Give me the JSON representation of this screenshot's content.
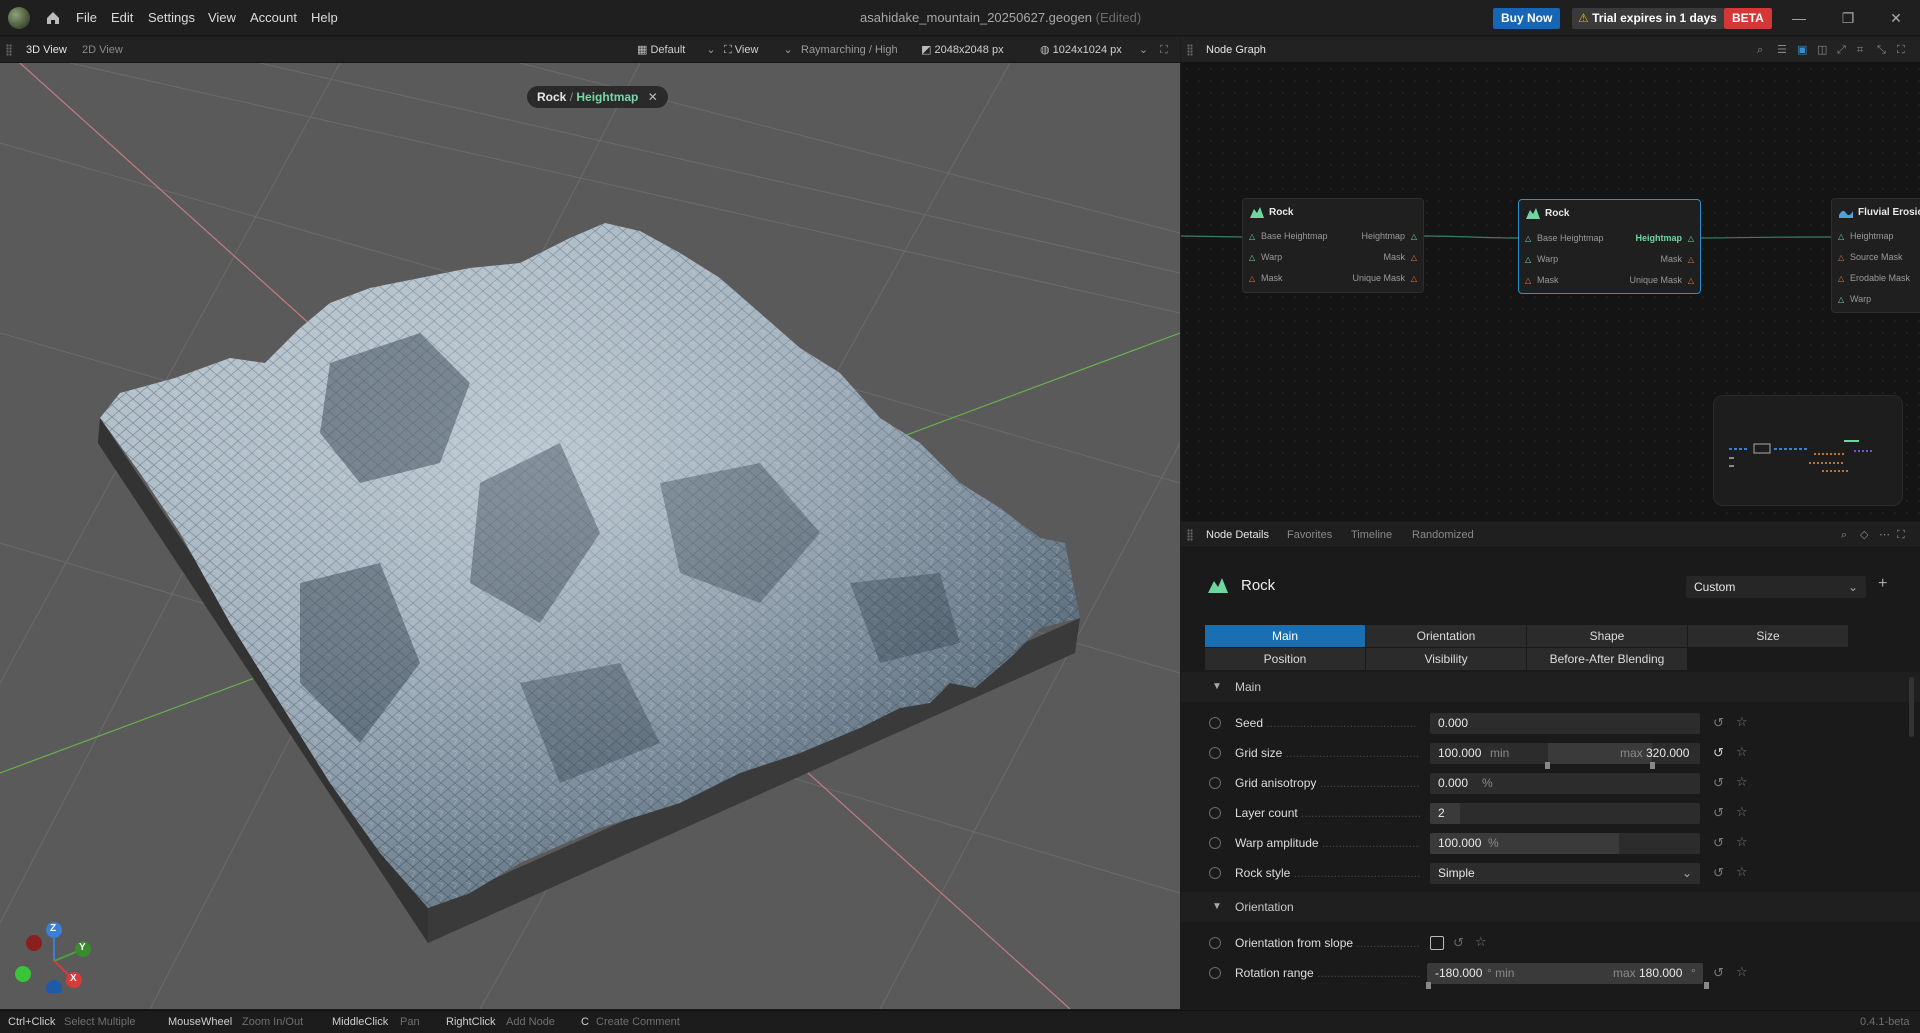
{
  "titlebar": {
    "menu": [
      "File",
      "Edit",
      "Settings",
      "View",
      "Account",
      "Help"
    ],
    "document_title": "asahidake_mountain_20250627.geogen",
    "edited_flag": "(Edited)",
    "buy_now": "Buy Now",
    "trial_text": "Trial expires in 1 days",
    "beta": "BETA"
  },
  "viewport_tabs": {
    "tabs": [
      "3D View",
      "2D View"
    ],
    "preset": "Default",
    "view": "View",
    "render_mode": "Raymarching / High",
    "resolution": "2048x2048 px",
    "preview_res": "1024x1024 px"
  },
  "viewport": {
    "breadcrumb_node": "Rock",
    "breadcrumb_sep": "/",
    "breadcrumb_output": "Heightmap",
    "axis_z": "Z",
    "axis_y": "Y",
    "axis_x": "X"
  },
  "graph": {
    "tab": "Node Graph",
    "nodes": [
      {
        "title": "Rock",
        "inputs": [
          "Base Heightmap",
          "Warp",
          "Mask"
        ],
        "outputs": [
          "Heightmap",
          "Mask",
          "Unique Mask"
        ]
      },
      {
        "title": "Rock",
        "inputs": [
          "Base Heightmap",
          "Warp",
          "Mask"
        ],
        "outputs": [
          "Heightmap",
          "Mask",
          "Unique Mask"
        ]
      },
      {
        "title": "Fluvial Erosio",
        "inputs": [
          "Heightmap",
          "Source Mask",
          "Erodable Mask",
          "Warp"
        ],
        "outputs": []
      }
    ]
  },
  "details": {
    "tabs": [
      "Node Details",
      "Favorites",
      "Timeline",
      "Randomized"
    ],
    "node_name": "Rock",
    "preset": "Custom",
    "param_tabs_row1": [
      "Main",
      "Orientation",
      "Shape",
      "Size"
    ],
    "param_tabs_row2": [
      "Position",
      "Visibility",
      "Before-After Blending"
    ],
    "section_main": "Main",
    "section_orientation": "Orientation",
    "params": {
      "seed": {
        "label": "Seed",
        "value": "0.000"
      },
      "grid_size": {
        "label": "Grid size",
        "min_value": "100.000",
        "min_label": "min",
        "max_label": "max",
        "max_value": "320.000"
      },
      "grid_anisotropy": {
        "label": "Grid anisotropy",
        "value": "0.000",
        "unit": "%"
      },
      "layer_count": {
        "label": "Layer count",
        "value": "2"
      },
      "warp_amplitude": {
        "label": "Warp amplitude",
        "value": "100.000",
        "unit": "%",
        "level": 0.7
      },
      "rock_style": {
        "label": "Rock style",
        "value": "Simple"
      },
      "orientation_from_slope": {
        "label": "Orientation from slope",
        "checked": false
      },
      "rotation_range": {
        "label": "Rotation range",
        "min_value": "-180.000",
        "min_unit": "° min",
        "max_label": "max",
        "max_value": "180.000",
        "max_unit": "°"
      }
    }
  },
  "statusbar": {
    "hints": [
      {
        "key": "Ctrl+Click",
        "desc": "Select Multiple"
      },
      {
        "key": "MouseWheel",
        "desc": "Zoom In/Out"
      },
      {
        "key": "MiddleClick",
        "desc": "Pan"
      },
      {
        "key": "RightClick",
        "desc": "Add Node"
      },
      {
        "key": "C",
        "desc": "Create Comment"
      }
    ],
    "version": "0.4.1-beta"
  }
}
